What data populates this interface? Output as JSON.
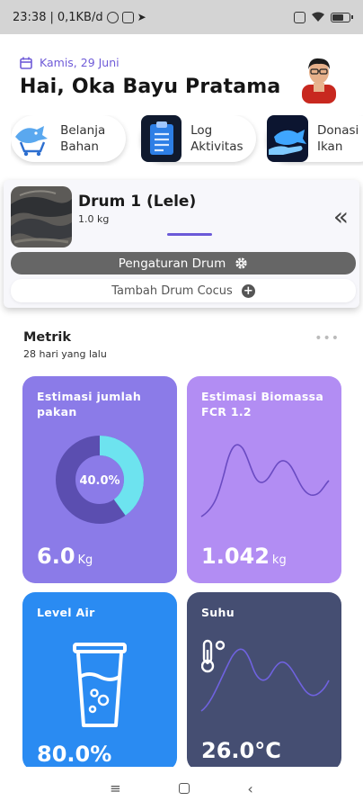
{
  "status": {
    "time": "23:38",
    "speed": "0,1KB/d"
  },
  "header": {
    "date": "Kamis, 29 Juni",
    "greeting": "Hai, Oka Bayu Pratama"
  },
  "quick_actions": [
    {
      "label": "Belanja Bahan",
      "icon": "fish-cart-icon"
    },
    {
      "label": "Log Aktivitas",
      "icon": "clipboard-icon"
    },
    {
      "label": "Donasi Ikan",
      "icon": "hand-fish-icon"
    }
  ],
  "drum": {
    "title": "Drum 1 (Lele)",
    "weight": "1.0 kg",
    "settings_label": "Pengaturan Drum",
    "add_label": "Tambah Drum Cocus"
  },
  "metrics": {
    "title": "Metrik",
    "subtitle": "28 hari yang lalu",
    "cards": [
      {
        "title": "Estimasi jumlah pakan",
        "value": "6.0",
        "unit": "Kg",
        "percent_label": "40.0%",
        "percent": 40.0,
        "color": "#8b7be8"
      },
      {
        "title": "Estimasi Biomassa FCR 1.2",
        "value": "1.042",
        "unit": "kg",
        "color": "#b28df3"
      },
      {
        "title": "Level Air",
        "value": "80.0%",
        "level": 80.0,
        "color": "#2a8bf2"
      },
      {
        "title": "Suhu",
        "value": "26.0°C",
        "color": "#454e72"
      }
    ]
  },
  "colors": {
    "accent": "#6b5ad8",
    "donut_fill": "#6de3ef",
    "donut_track": "#5b4eb0"
  }
}
